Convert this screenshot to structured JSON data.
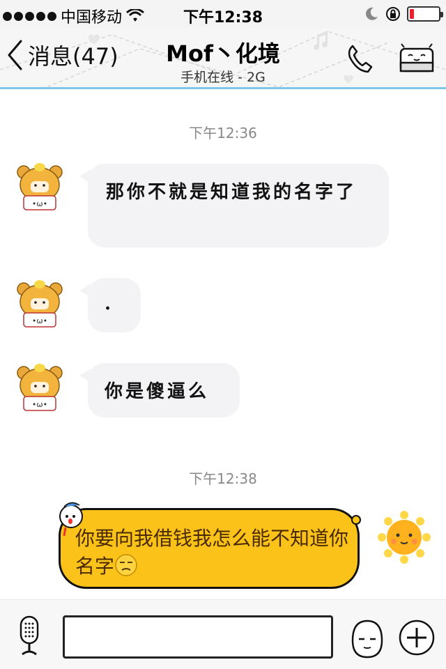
{
  "status_bar": {
    "carrier": "中国移动",
    "time": "下午12:38",
    "battery_level": 0.15
  },
  "nav": {
    "back_label": "消息(47)",
    "title": "Mof丶化境",
    "subtitle": "手机在线 - 2G"
  },
  "messages": [
    {
      "timestamp": "下午12:36"
    },
    {
      "text": "那你不就是知道我的名字了"
    },
    {
      "text": "."
    },
    {
      "text": "你是傻逼么"
    },
    {
      "timestamp": "下午12:38"
    },
    {
      "text": "你要向我借钱我怎么能不知道你名字"
    }
  ],
  "input": {
    "placeholder": ""
  },
  "colors": {
    "accent_line": "#7fc7e6",
    "outgoing_bubble": "#fbc319",
    "incoming_bubble": "#f3f3f5",
    "battery_low": "#e8202a"
  },
  "icons": [
    "wifi-icon",
    "moon-icon",
    "rotation-lock-icon",
    "battery-icon",
    "back-chevron-icon",
    "phone-icon",
    "profile-face-icon",
    "bear-avatar-icon",
    "sun-avatar-icon",
    "unamused-emoji-icon",
    "microphone-icon",
    "emoji-face-icon",
    "plus-icon"
  ]
}
